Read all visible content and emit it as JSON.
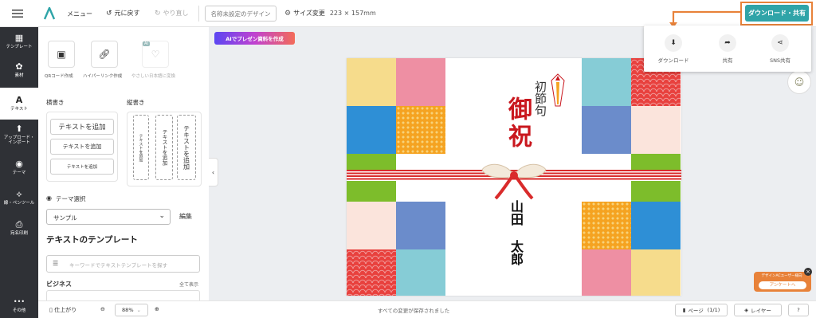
{
  "header": {
    "menu_label": "メニュー",
    "undo_label": "元に戻す",
    "redo_label": "やり直し",
    "doc_name": "名称未設定のデザイン",
    "size_label": "サイズ変更",
    "size_value": "223 × 157mm",
    "download_share_label": "ダウンロード・共有"
  },
  "sidebar": {
    "items": [
      {
        "label": "テンプレート"
      },
      {
        "label": "素材"
      },
      {
        "label": "テキスト"
      },
      {
        "label": "アップロード・インポート"
      },
      {
        "label": "テーマ"
      },
      {
        "label": "線・ペンツール"
      },
      {
        "label": "宛名印刷"
      },
      {
        "label": "その他"
      }
    ]
  },
  "panel": {
    "tools": [
      {
        "label": "QRコード作成"
      },
      {
        "label": "ハイパーリンク作成"
      },
      {
        "label": "やさしい日本語に変換",
        "badge": "AI"
      }
    ],
    "horizontal_title": "横書き",
    "vertical_title": "縦書き",
    "add_text_large": "テキストを追加",
    "add_text_medium": "テキストを追加",
    "add_text_small": "テキストを追加",
    "theme_title": "テーマ選択",
    "theme_value": "サンプル",
    "theme_edit": "編集",
    "template_title": "テキストのテンプレート",
    "search_placeholder": "キーワードでテキストテンプレートを探す",
    "business_label": "ビジネス",
    "show_all": "全て表示"
  },
  "canvas": {
    "ai_button": "AIでプレゼン資料を作成",
    "card_text": {
      "hatsu_sekku": "初節句",
      "goiwai": "御祝",
      "surname": "山田",
      "given_name": "太郎"
    }
  },
  "share_popup": {
    "download_label": "ダウンロード",
    "share_label": "共有",
    "sns_label": "SNS共有"
  },
  "survey": {
    "title": "デザインACユーザー様向",
    "button": "アンケートへ"
  },
  "bottom_bar": {
    "finish_label": "仕上がり",
    "zoom_value": "88%",
    "save_status": "すべての変更が保存されました",
    "page_label": "ページ",
    "page_count": "(1/1)",
    "layer_label": "レイヤー",
    "help_label": "?"
  },
  "colors": {
    "accent_teal": "#2fa4a8",
    "highlight_orange": "#e8823a",
    "sidebar_bg": "#2f3136",
    "goiwai_red": "#c9171e"
  }
}
